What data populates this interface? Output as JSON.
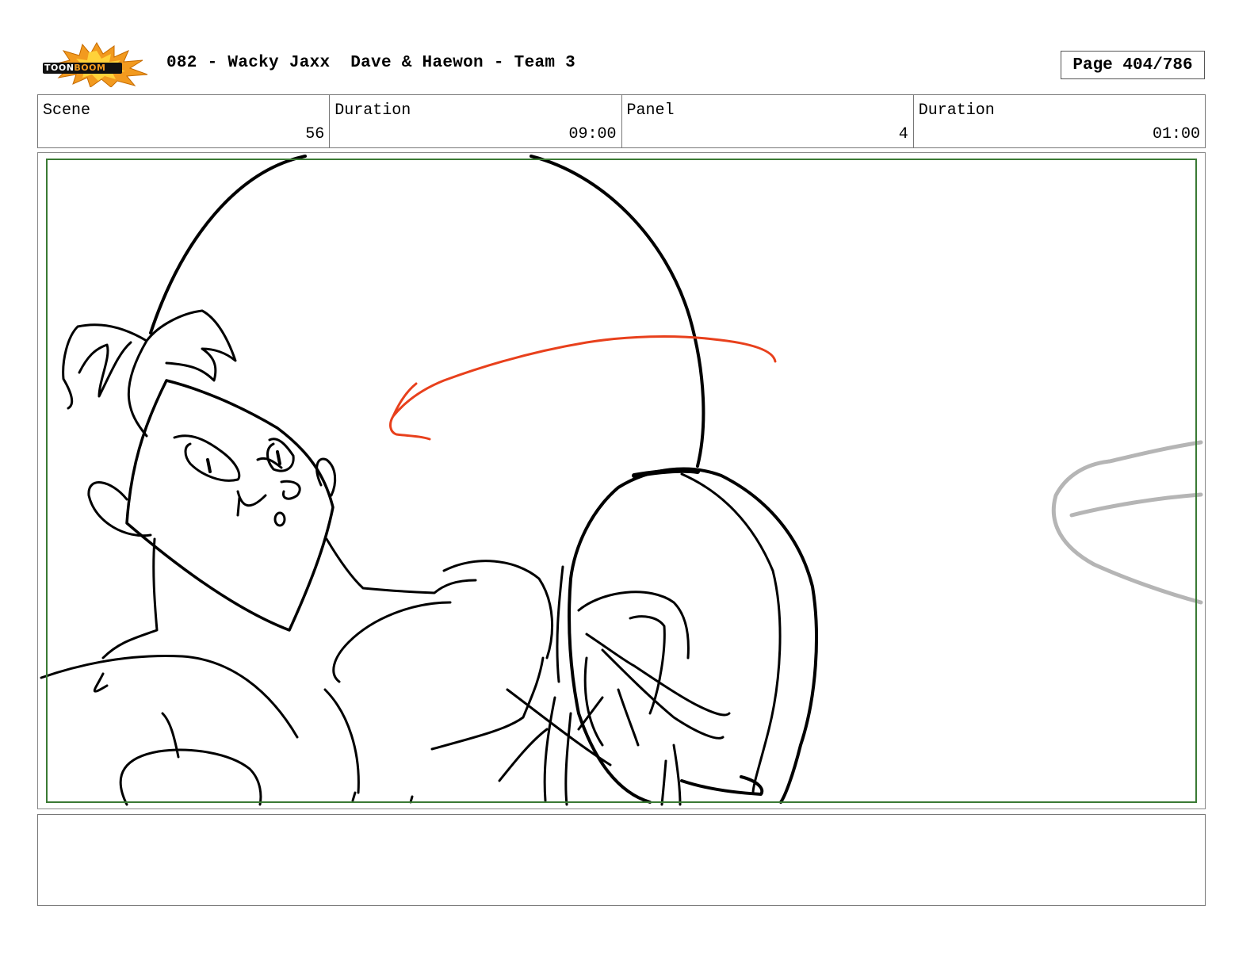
{
  "header": {
    "logo_text": "TOON BOOM",
    "title": "082 - Wacky Jaxx  Dave & Haewon - Team 3",
    "page": "Page 404/786"
  },
  "info": {
    "scene_label": "Scene",
    "scene_value": "56",
    "scene_duration_label": "Duration",
    "scene_duration_value": "09:00",
    "panel_label": "Panel",
    "panel_value": "4",
    "panel_duration_label": "Duration",
    "panel_duration_value": "01:00"
  },
  "notes": {
    "text": ""
  },
  "colors": {
    "safe_frame": "#3a7a34",
    "motion_arrow": "#e8401c",
    "sketch_line": "#000000",
    "ghost_line": "#b5b5b5"
  }
}
